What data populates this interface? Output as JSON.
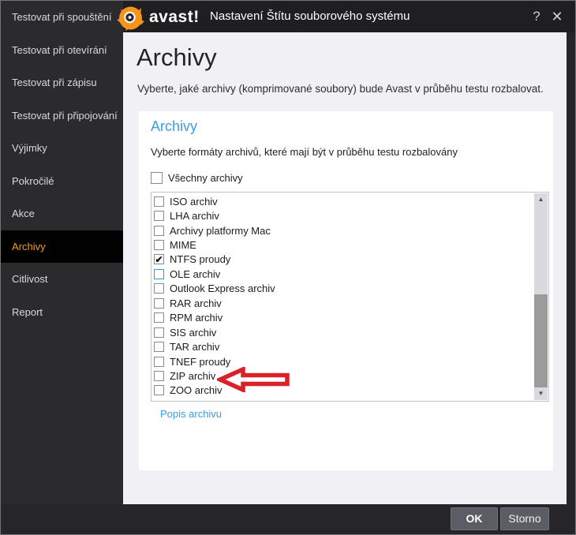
{
  "window": {
    "brand": "avast!",
    "title": "Nastavení Štítu souborového systému"
  },
  "icons": {
    "help": "?",
    "close": "✕",
    "scroll_up": "▲",
    "scroll_down": "▼",
    "checkmark": "✔"
  },
  "sidebar": {
    "items": [
      {
        "label": "Testovat při spouštění",
        "selected": false
      },
      {
        "label": "Testovat při otevírání",
        "selected": false
      },
      {
        "label": "Testovat při zápisu",
        "selected": false
      },
      {
        "label": "Testovat při připojování",
        "selected": false
      },
      {
        "label": "Výjimky",
        "selected": false
      },
      {
        "label": "Pokročilé",
        "selected": false
      },
      {
        "label": "Akce",
        "selected": false
      },
      {
        "label": "Archivy",
        "selected": true
      },
      {
        "label": "Citlivost",
        "selected": false
      },
      {
        "label": "Report",
        "selected": false
      }
    ]
  },
  "main": {
    "heading": "Archivy",
    "description": "Vyberte, jaké archivy (komprimované soubory) bude Avast v průběhu testu rozbalovat.",
    "panel": {
      "heading": "Archivy",
      "subheading": "Vyberte formáty archivů, které mají být v průběhu testu rozbalovány",
      "select_all": {
        "label": "Všechny archivy",
        "checked": false
      },
      "items": [
        {
          "label": "ISO archiv",
          "checked": false
        },
        {
          "label": "LHA archiv",
          "checked": false
        },
        {
          "label": "Archivy platformy Mac",
          "checked": false
        },
        {
          "label": "MIME",
          "checked": false
        },
        {
          "label": "NTFS proudy",
          "checked": true
        },
        {
          "label": "OLE archiv",
          "checked": false,
          "focused": true
        },
        {
          "label": "Outlook Express archiv",
          "checked": false
        },
        {
          "label": "RAR archiv",
          "checked": false
        },
        {
          "label": "RPM archiv",
          "checked": false
        },
        {
          "label": "SIS archiv",
          "checked": false
        },
        {
          "label": "TAR archiv",
          "checked": false
        },
        {
          "label": "TNEF proudy",
          "checked": false
        },
        {
          "label": "ZIP archiv",
          "checked": false,
          "annotated": true
        },
        {
          "label": "ZOO archiv",
          "checked": false
        }
      ],
      "link_label": "Popis archivu"
    }
  },
  "footer": {
    "ok_label": "OK",
    "cancel_label": "Storno"
  },
  "colors": {
    "accent_orange": "#f7941d",
    "sidebar_selected_text": "#ef9b0f",
    "accent_blue": "#3d9be3",
    "focus_border": "#26a0da",
    "annotation_red": "#da2128",
    "content_bg": "#f1f1f5",
    "dark_bg": "#26262a",
    "button_bg": "#5a5d64"
  }
}
